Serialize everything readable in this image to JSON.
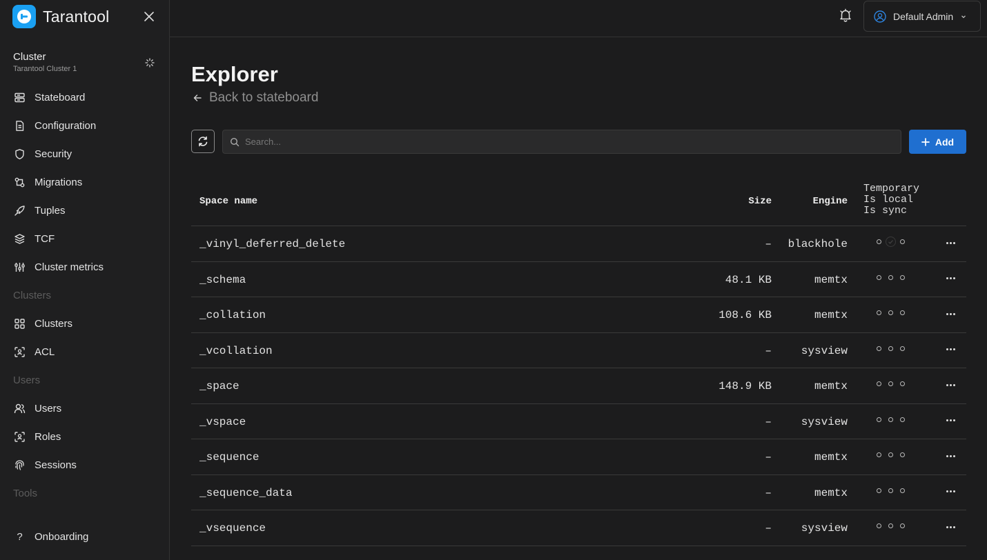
{
  "app": {
    "name": "Tarantool"
  },
  "cluster": {
    "title": "Cluster",
    "subtitle": "Tarantool Cluster 1"
  },
  "nav": {
    "items1": [
      {
        "label": "Stateboard",
        "icon": "server-icon"
      },
      {
        "label": "Configuration",
        "icon": "document-icon"
      },
      {
        "label": "Security",
        "icon": "shield-icon"
      },
      {
        "label": "Migrations",
        "icon": "migrations-icon"
      },
      {
        "label": "Tuples",
        "icon": "rocket-icon"
      },
      {
        "label": "TCF",
        "icon": "layers-icon"
      },
      {
        "label": "Cluster metrics",
        "icon": "sliders-icon"
      }
    ],
    "group_clusters": "Clusters",
    "items2": [
      {
        "label": "Clusters",
        "icon": "grid-icon"
      },
      {
        "label": "ACL",
        "icon": "scan-icon"
      }
    ],
    "group_users": "Users",
    "items3": [
      {
        "label": "Users",
        "icon": "users-icon"
      },
      {
        "label": "Roles",
        "icon": "scan-icon"
      },
      {
        "label": "Sessions",
        "icon": "fingerprint-icon"
      }
    ],
    "group_tools": "Tools",
    "onboarding": "Onboarding"
  },
  "header": {
    "user": "Default Admin"
  },
  "main": {
    "title": "Explorer",
    "back_link": "Back to stateboard",
    "search_placeholder": "Search...",
    "add_label": "Add"
  },
  "table": {
    "headers": {
      "name": "Space name",
      "size": "Size",
      "engine": "Engine",
      "temporary": "Temporary",
      "is_local": "Is local",
      "is_sync": "Is sync"
    },
    "rows": [
      {
        "name": "_vinyl_deferred_delete",
        "size": "–",
        "engine": "blackhole",
        "local": true
      },
      {
        "name": "_schema",
        "size": "48.1 KB",
        "engine": "memtx",
        "local": false
      },
      {
        "name": "_collation",
        "size": "108.6 KB",
        "engine": "memtx",
        "local": false
      },
      {
        "name": "_vcollation",
        "size": "–",
        "engine": "sysview",
        "local": false
      },
      {
        "name": "_space",
        "size": "148.9 KB",
        "engine": "memtx",
        "local": false
      },
      {
        "name": "_vspace",
        "size": "–",
        "engine": "sysview",
        "local": false
      },
      {
        "name": "_sequence",
        "size": "–",
        "engine": "memtx",
        "local": false
      },
      {
        "name": "_sequence_data",
        "size": "–",
        "engine": "memtx",
        "local": false
      },
      {
        "name": "_vsequence",
        "size": "–",
        "engine": "sysview",
        "local": false
      }
    ]
  },
  "colors": {
    "accent": "#1f6fd0",
    "logo": "#1aa0f2",
    "background": "#1c1c1d"
  }
}
